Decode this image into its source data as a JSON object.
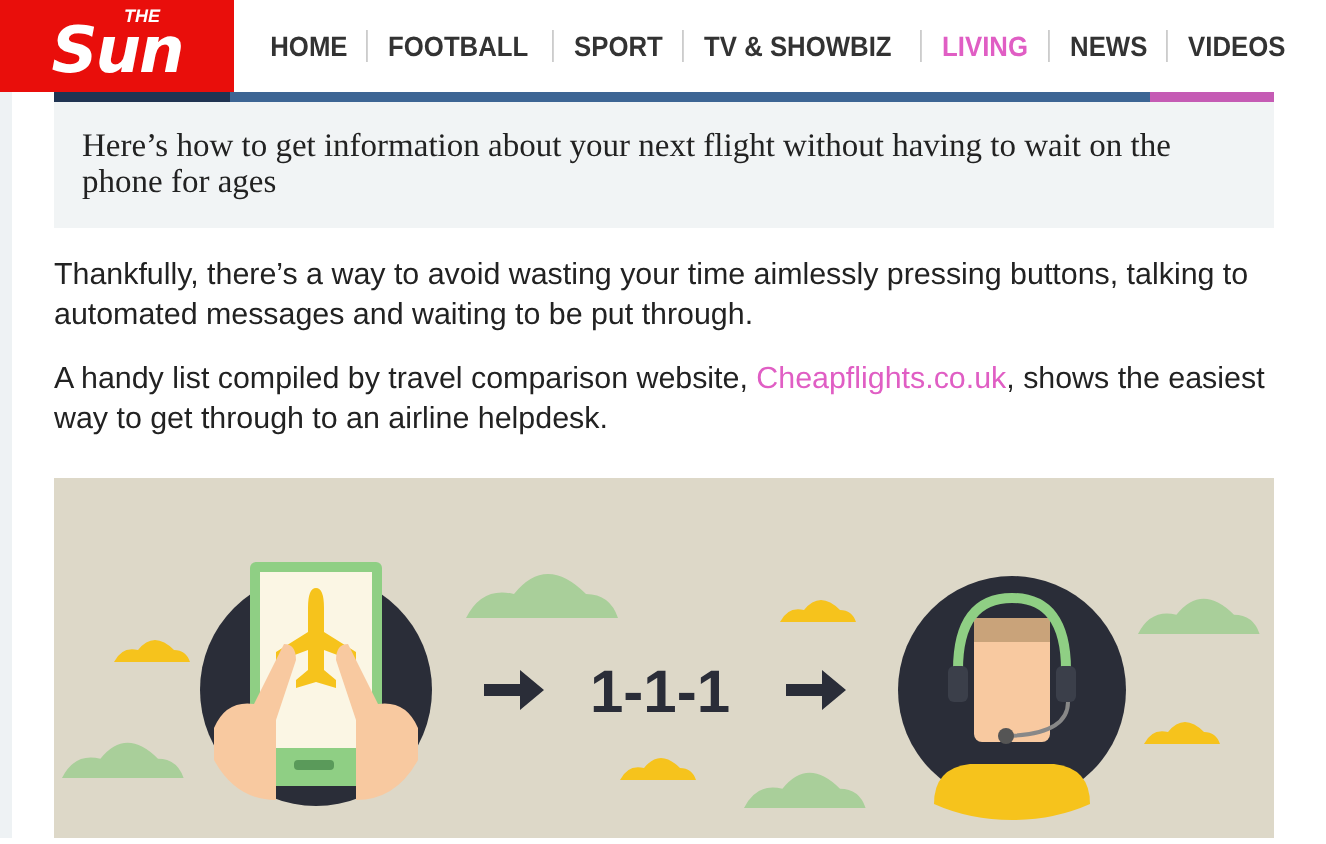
{
  "header": {
    "logo": {
      "small": "THE",
      "large": "Sun"
    },
    "nav": [
      {
        "label": "HOME",
        "selected": false
      },
      {
        "label": "FOOTBALL",
        "selected": false
      },
      {
        "label": "SPORT",
        "selected": false
      },
      {
        "label": "TV & SHOWBIZ",
        "selected": false
      },
      {
        "label": "LIVING",
        "selected": true
      },
      {
        "label": "NEWS",
        "selected": false
      },
      {
        "label": "VIDEOS",
        "selected": false
      }
    ]
  },
  "caption": "Here’s how to get information about your next flight without having to wait on the phone for ages",
  "paragraphs": [
    {
      "parts": [
        {
          "kind": "text",
          "text": "Thankfully, there’s a way to avoid wasting your time aimlessly pressing buttons, talking to automated messages and waiting to be put through."
        }
      ]
    },
    {
      "parts": [
        {
          "kind": "text",
          "text": "A handy list compiled by travel comparison website, "
        },
        {
          "kind": "link",
          "text": "Cheapflights.co.uk"
        },
        {
          "kind": "text",
          "text": ", shows the easiest way to get through to an airline helpdesk."
        }
      ]
    }
  ],
  "infographic": {
    "label": "1-1-1"
  }
}
